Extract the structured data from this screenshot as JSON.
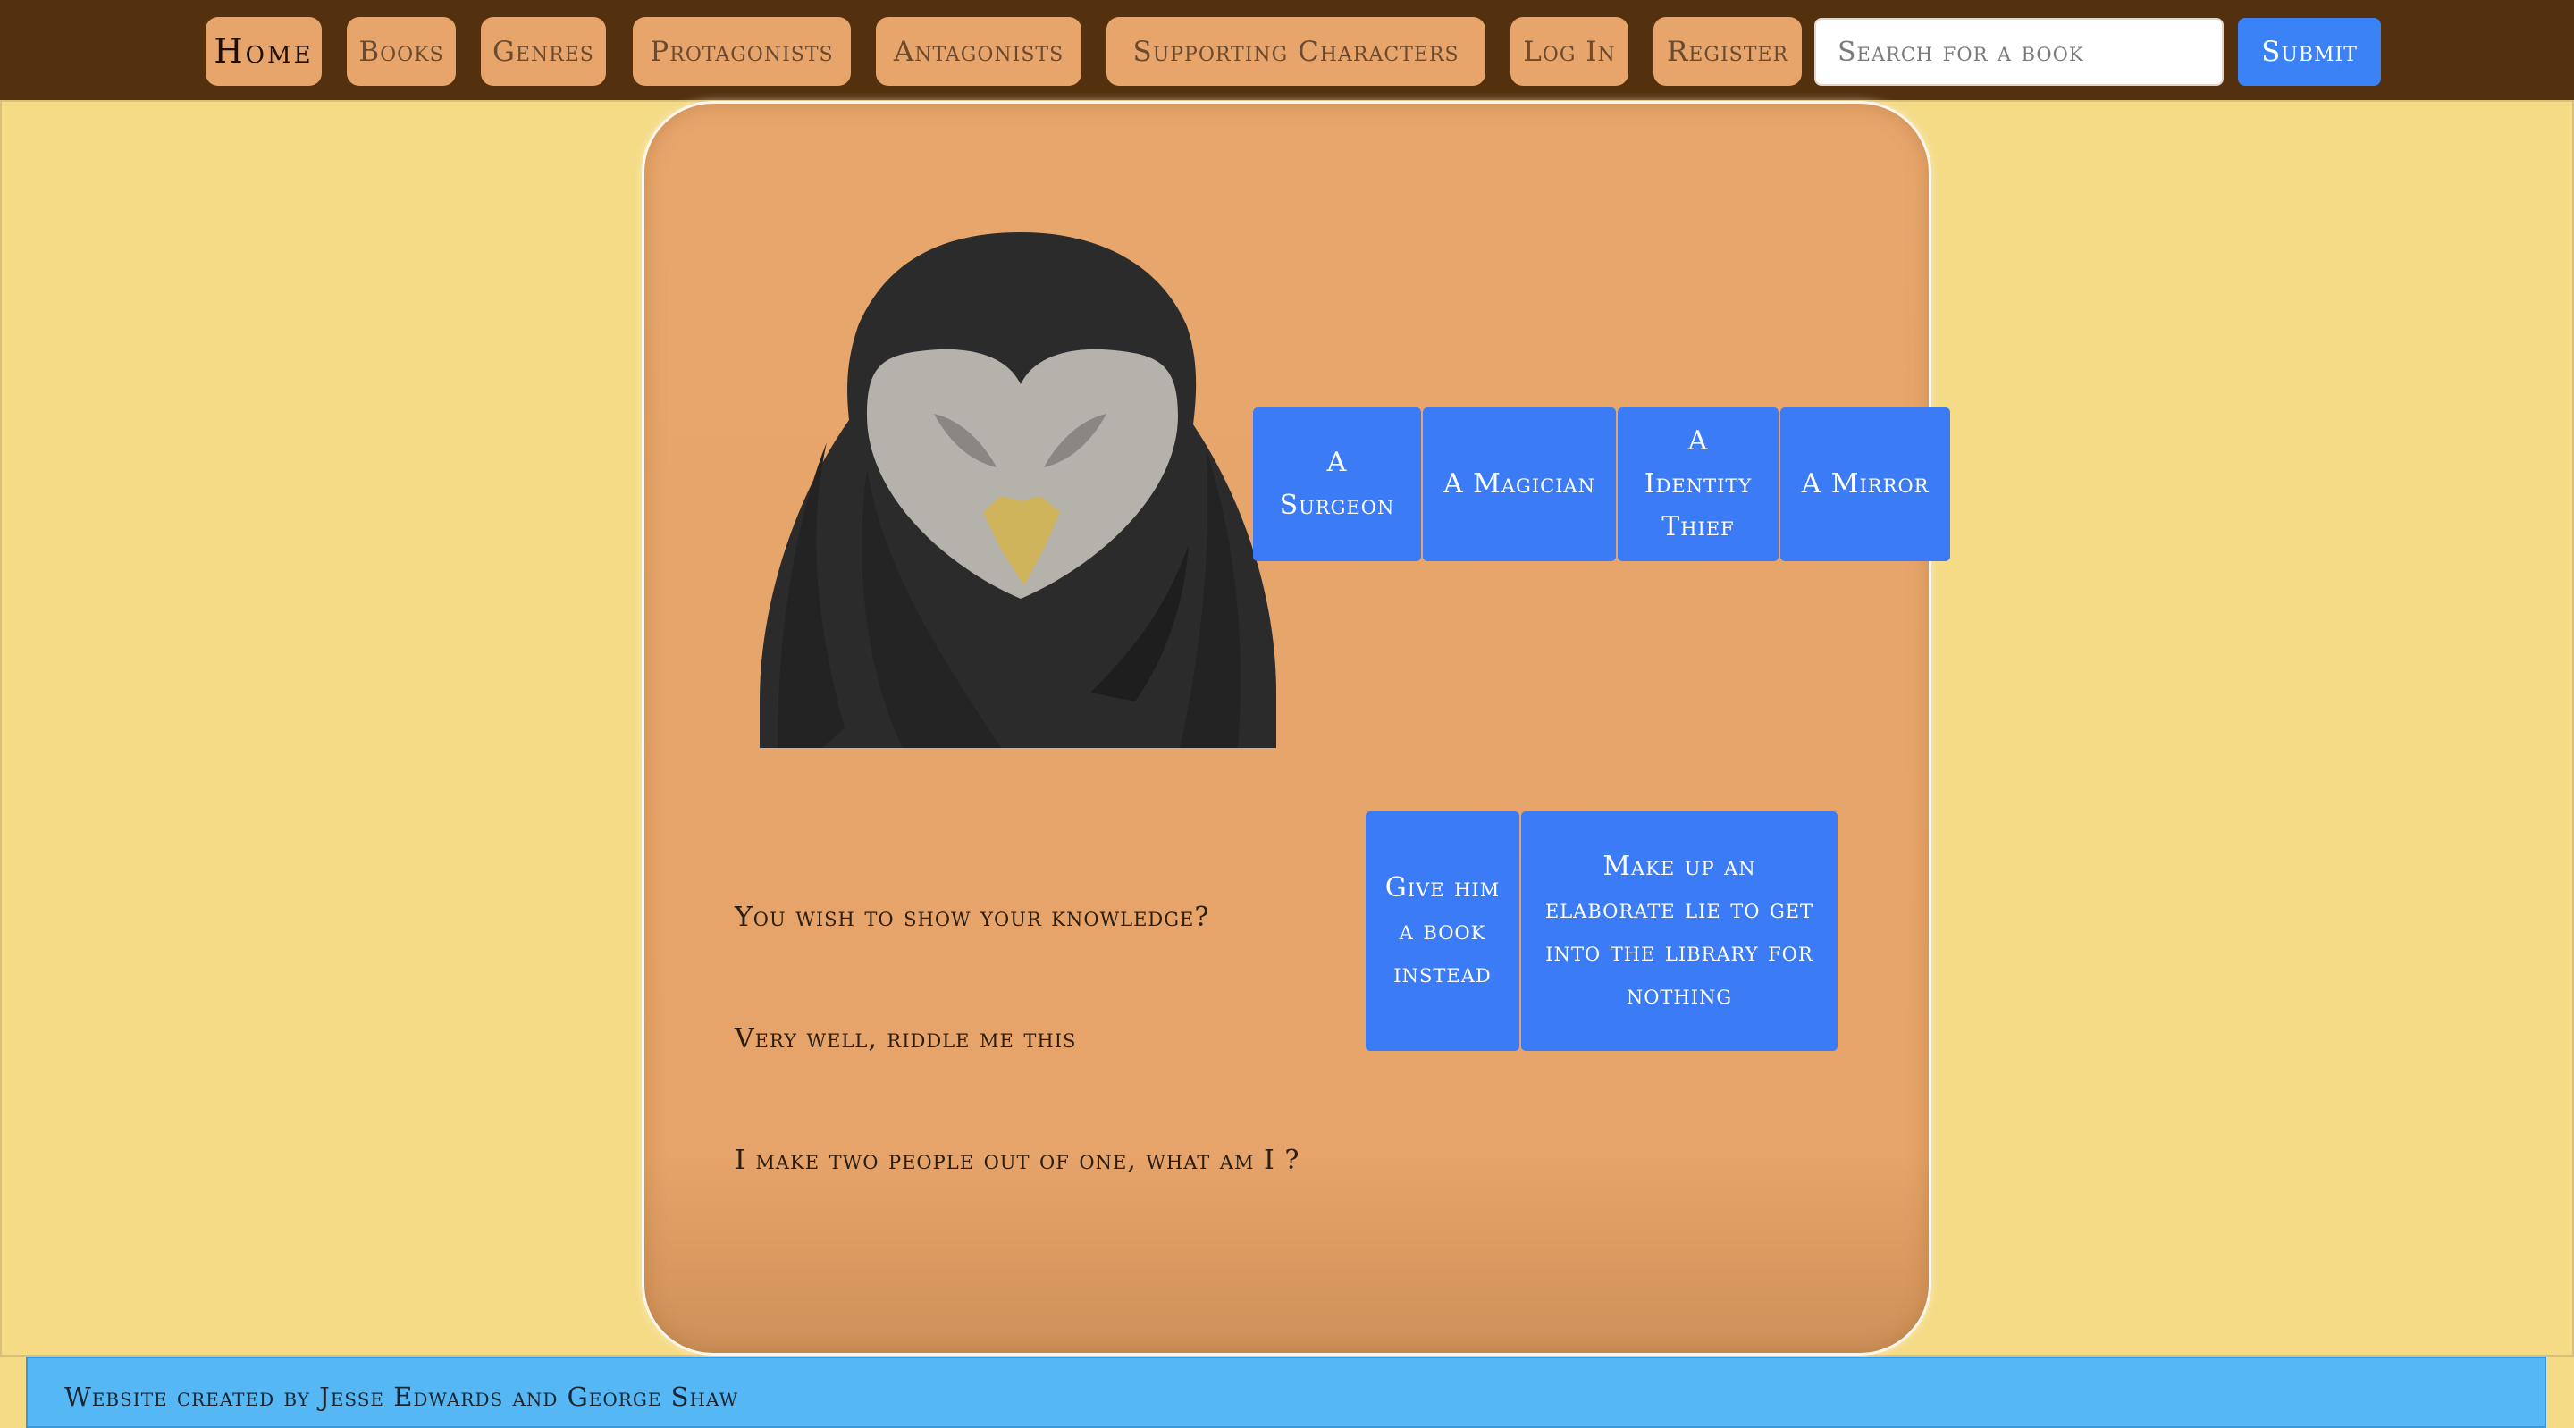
{
  "nav": {
    "items": [
      {
        "label": "Home"
      },
      {
        "label": "Books"
      },
      {
        "label": "Genres"
      },
      {
        "label": "Protagonists"
      },
      {
        "label": "Antagonists"
      },
      {
        "label": "Supporting Characters"
      },
      {
        "label": "Log In"
      },
      {
        "label": "Register"
      }
    ],
    "search_placeholder": "Search for a book",
    "submit_label": "Submit"
  },
  "game": {
    "character_icon": "owl-icon",
    "answers": [
      {
        "label": "A Surgeon"
      },
      {
        "label": "A Magician"
      },
      {
        "label": "A Identity Thief"
      },
      {
        "label": "A Mirror"
      }
    ],
    "alternatives": [
      {
        "label": "Give him a book instead"
      },
      {
        "label": "Make up an elaborate lie to get into the library for nothing"
      }
    ],
    "dialogue": [
      "You wish to show your knowledge?",
      "Very well, riddle me this",
      "I make two people out of one, what am I ?"
    ]
  },
  "footer": {
    "text": "Website created by Jesse Edwards and George Shaw"
  },
  "colors": {
    "nav_background": "#53310f",
    "nav_button": "#e7a56c",
    "page_background": "#f5db86",
    "card_background": "#e7a66c",
    "accent_blue": "#3b82f6",
    "footer_background": "#55b8f5"
  }
}
